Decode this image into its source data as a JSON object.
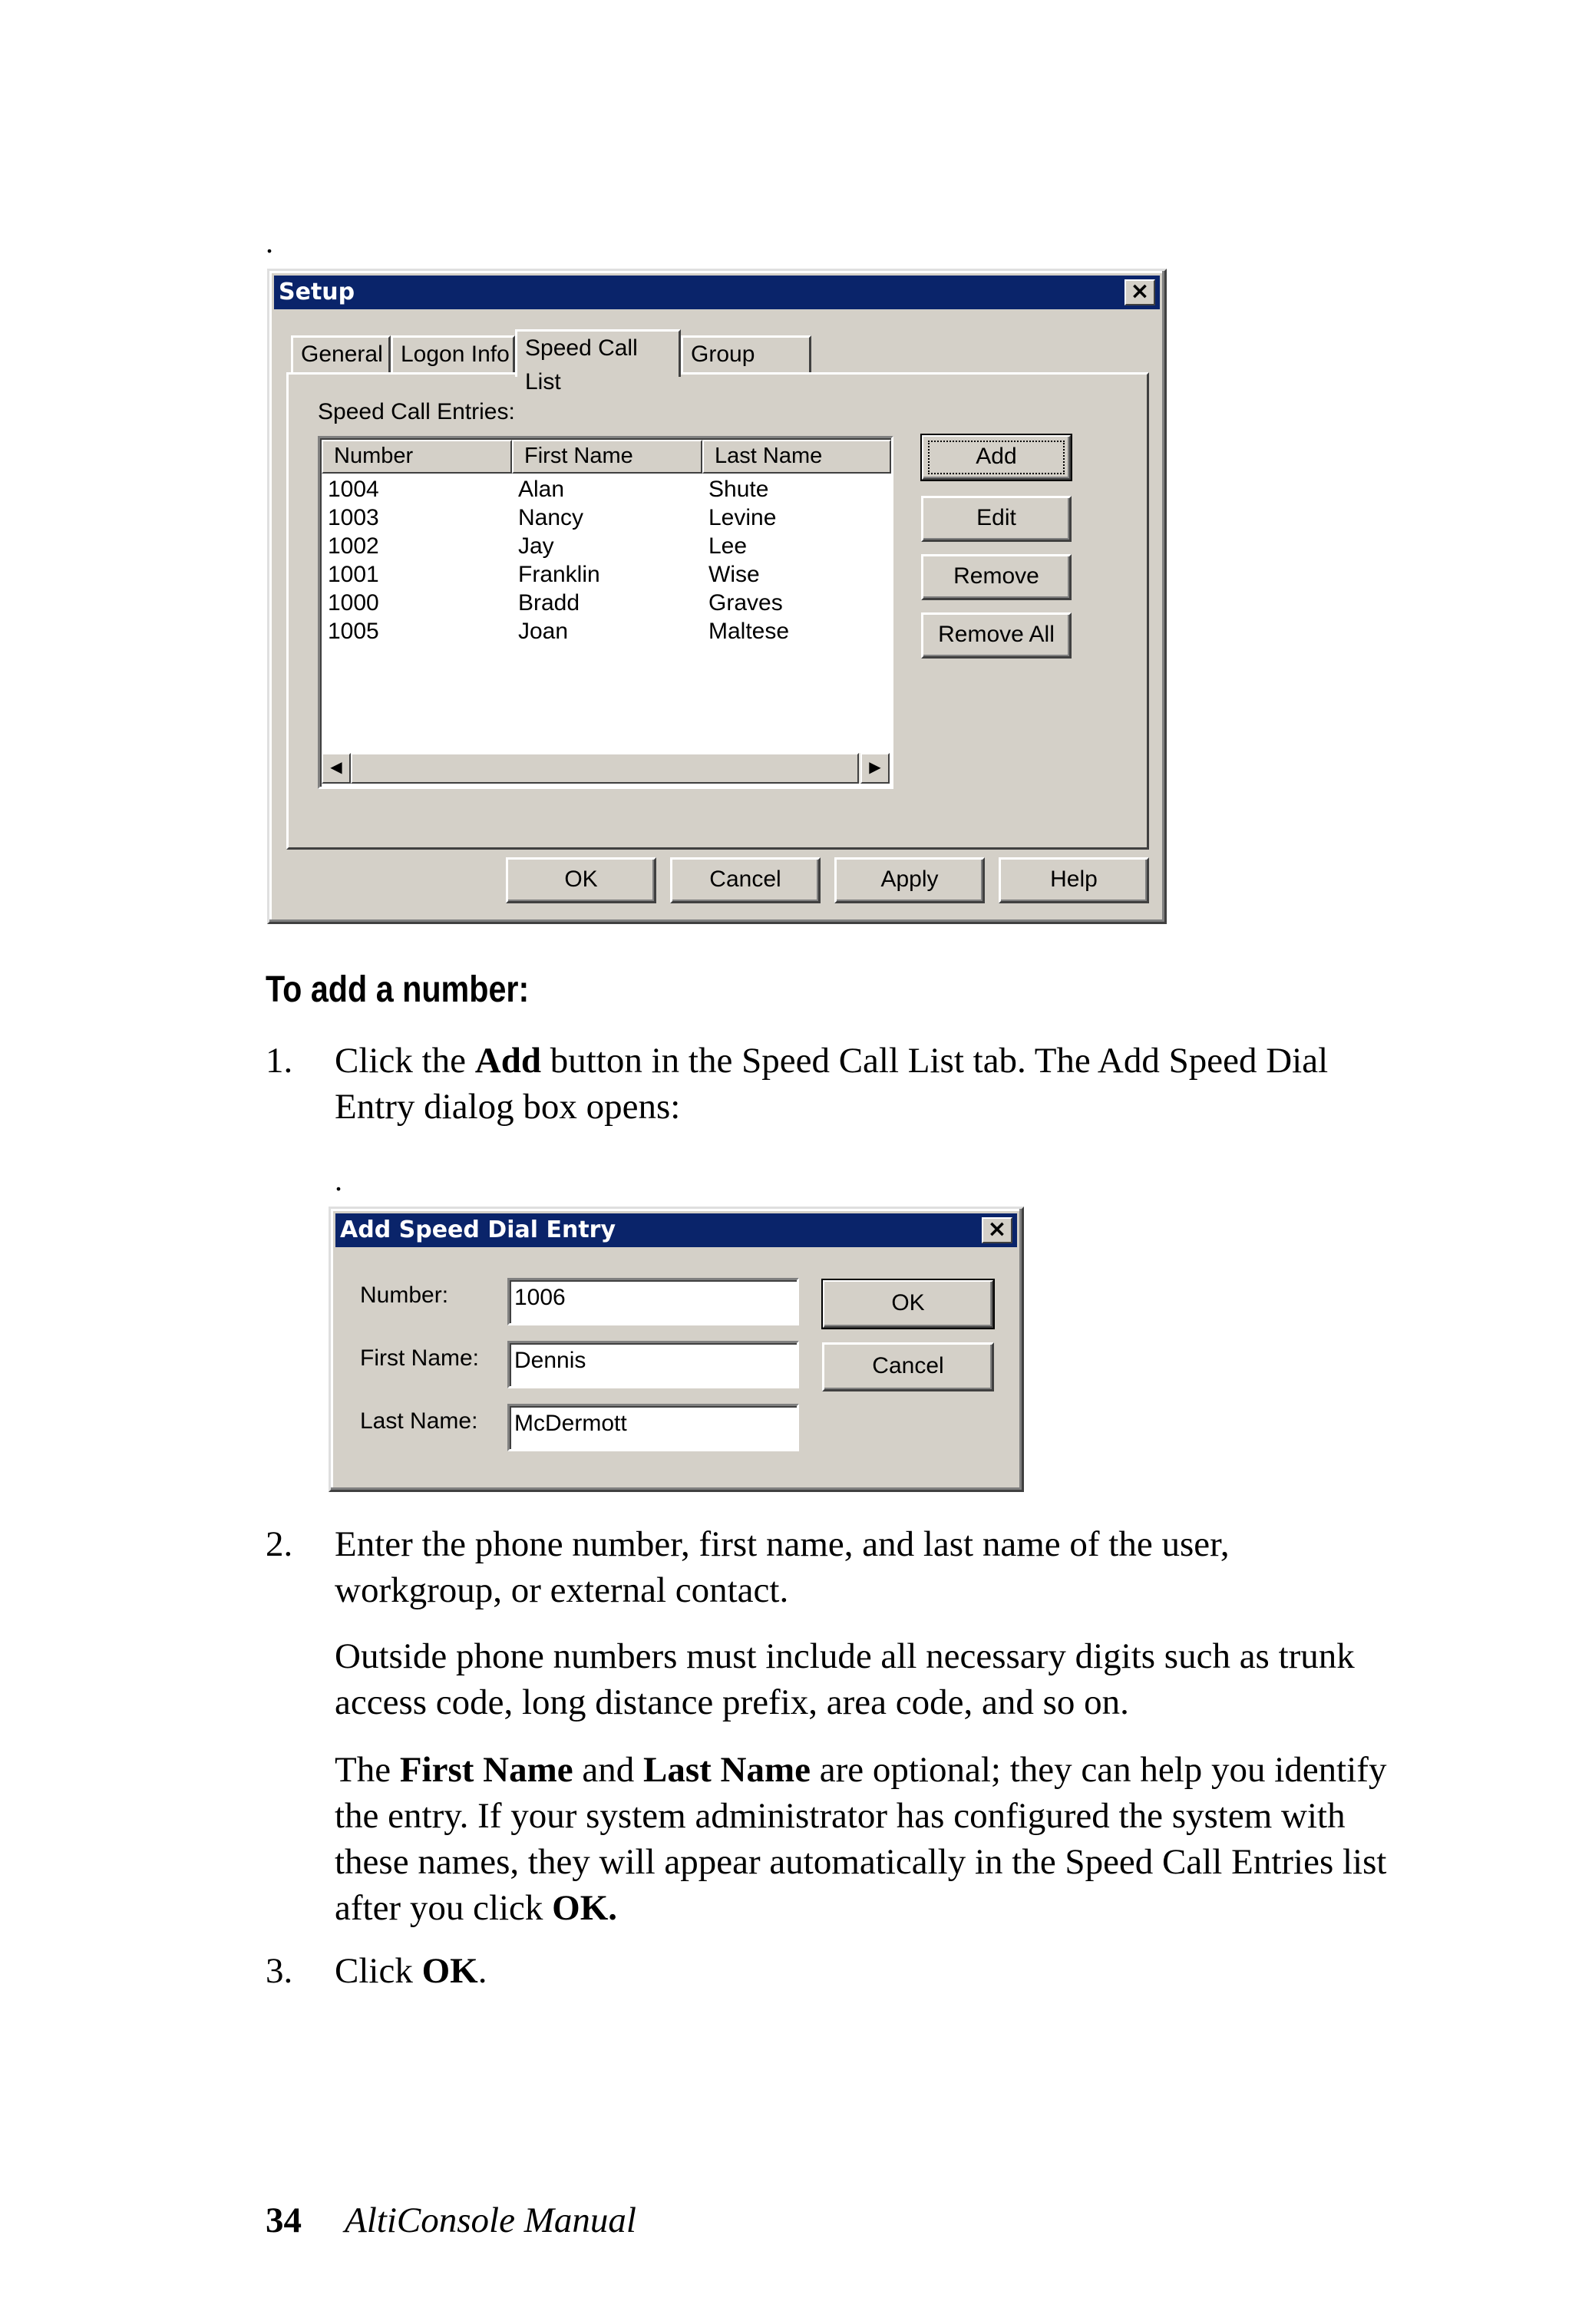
{
  "setup_dialog": {
    "title": "Setup",
    "close_glyph": "×",
    "tabs": [
      "General",
      "Logon Info",
      "Speed Call List",
      "Group"
    ],
    "section_label": "Speed Call Entries:",
    "columns": [
      "Number",
      "First Name",
      "Last Name"
    ],
    "rows": [
      {
        "number": "1004",
        "first": "Alan",
        "last": "Shute"
      },
      {
        "number": "1003",
        "first": "Nancy",
        "last": "Levine"
      },
      {
        "number": "1002",
        "first": "Jay",
        "last": "Lee"
      },
      {
        "number": "1001",
        "first": "Franklin",
        "last": "Wise"
      },
      {
        "number": "1000",
        "first": "Bradd",
        "last": "Graves"
      },
      {
        "number": "1005",
        "first": "Joan",
        "last": "Maltese"
      }
    ],
    "side_buttons": [
      "Add",
      "Edit",
      "Remove",
      "Remove All"
    ],
    "bottom_buttons": [
      "OK",
      "Cancel",
      "Apply",
      "Help"
    ]
  },
  "heading": "To add a number:",
  "step1_num": "1.",
  "step1_parts": [
    "Click the ",
    "Add",
    " button in the Speed Call List tab. The Add Speed Dial Entry dialog box opens:"
  ],
  "add_dialog": {
    "title": "Add Speed Dial Entry",
    "close_glyph": "×",
    "labels": {
      "number": "Number:",
      "first": "First Name:",
      "last": "Last Name:"
    },
    "values": {
      "number": "1006",
      "first": "Dennis",
      "last": "McDermott"
    },
    "ok": "OK",
    "cancel": "Cancel"
  },
  "step2_num": "2.",
  "step2_text": "Enter the phone number, first name, and last name of the user, workgroup, or external contact.",
  "para_outside": "Outside phone numbers must include all necessary digits such as trunk access code, long distance prefix, area code, and so on.",
  "para_optional_parts": [
    "The ",
    "First Name",
    " and ",
    "Last Name",
    " are optional; they can help you identify the entry. If your system administrator has configured the system with these names, they will appear automatically in the Speed Call Entries list after you click ",
    "OK."
  ],
  "step3_num": "3.",
  "step3_parts": [
    "Click ",
    "OK",
    "."
  ],
  "footer": {
    "page": "34",
    "title": "AltiConsole Manual"
  },
  "stray_dot": "."
}
